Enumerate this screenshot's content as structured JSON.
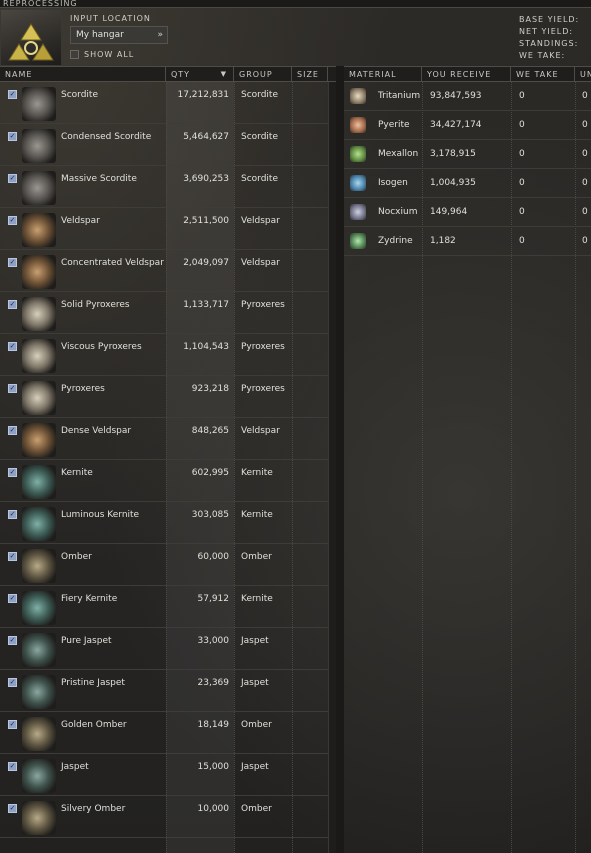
{
  "window": {
    "title": "REPROCESSING"
  },
  "input": {
    "location_label": "INPUT LOCATION",
    "location_value": "My hangar",
    "show_all_label": "SHOW ALL"
  },
  "summary": {
    "base_yield": "BASE YIELD:",
    "net_yield": "NET YIELD:",
    "standings": "STANDINGS:",
    "we_take": "WE TAKE:"
  },
  "items_table": {
    "columns": [
      "NAME",
      "QTY",
      "GROUP",
      "SIZE"
    ],
    "sort_indicator": "▼",
    "rows": [
      {
        "name": "Scordite",
        "qty": "17,212,831",
        "group": "Scordite"
      },
      {
        "name": "Condensed Scordite",
        "qty": "5,464,627",
        "group": "Scordite"
      },
      {
        "name": "Massive Scordite",
        "qty": "3,690,253",
        "group": "Scordite"
      },
      {
        "name": "Veldspar",
        "qty": "2,511,500",
        "group": "Veldspar"
      },
      {
        "name": "Concentrated Veldspar",
        "qty": "2,049,097",
        "group": "Veldspar"
      },
      {
        "name": "Solid Pyroxeres",
        "qty": "1,133,717",
        "group": "Pyroxeres"
      },
      {
        "name": "Viscous Pyroxeres",
        "qty": "1,104,543",
        "group": "Pyroxeres"
      },
      {
        "name": "Pyroxeres",
        "qty": "923,218",
        "group": "Pyroxeres"
      },
      {
        "name": "Dense Veldspar",
        "qty": "848,265",
        "group": "Veldspar"
      },
      {
        "name": "Kernite",
        "qty": "602,995",
        "group": "Kernite"
      },
      {
        "name": "Luminous Kernite",
        "qty": "303,085",
        "group": "Kernite"
      },
      {
        "name": "Omber",
        "qty": "60,000",
        "group": "Omber"
      },
      {
        "name": "Fiery Kernite",
        "qty": "57,912",
        "group": "Kernite"
      },
      {
        "name": "Pure Jaspet",
        "qty": "33,000",
        "group": "Jaspet"
      },
      {
        "name": "Pristine Jaspet",
        "qty": "23,369",
        "group": "Jaspet"
      },
      {
        "name": "Golden Omber",
        "qty": "18,149",
        "group": "Omber"
      },
      {
        "name": "Jaspet",
        "qty": "15,000",
        "group": "Jaspet"
      },
      {
        "name": "Silvery Omber",
        "qty": "10,000",
        "group": "Omber"
      }
    ]
  },
  "materials_table": {
    "columns": [
      "MATERIAL",
      "YOU RECEIVE",
      "WE TAKE",
      "UN"
    ],
    "rows": [
      {
        "material": "Tritanium",
        "you_receive": "93,847,593",
        "we_take": "0",
        "un": "0"
      },
      {
        "material": "Pyerite",
        "you_receive": "34,427,174",
        "we_take": "0",
        "un": "0"
      },
      {
        "material": "Mexallon",
        "you_receive": "3,178,915",
        "we_take": "0",
        "un": "0"
      },
      {
        "material": "Isogen",
        "you_receive": "1,004,935",
        "we_take": "0",
        "un": "0"
      },
      {
        "material": "Nocxium",
        "you_receive": "149,964",
        "we_take": "0",
        "un": "0"
      },
      {
        "material": "Zydrine",
        "you_receive": "1,182",
        "we_take": "0",
        "un": "0"
      }
    ]
  },
  "icons": {
    "logo": "reprocessing-logo-icon",
    "checkbox": "checked-checkbox-icon",
    "dropdown": "chevron-down-icon"
  }
}
